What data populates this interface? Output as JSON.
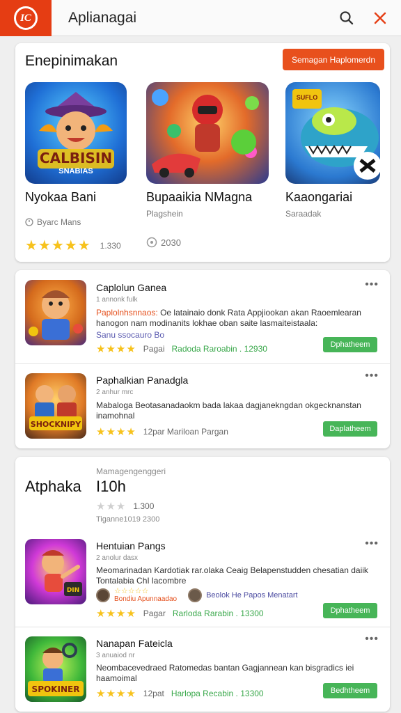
{
  "header": {
    "logo_letters": "IC",
    "title": "Aplianagai",
    "search_icon": "search-icon",
    "close_icon": "close-icon",
    "accent": "#e53d13"
  },
  "featured": {
    "title": "Enepinimakan",
    "button_label": "Semagan Haplomerdn",
    "items": [
      {
        "name": "Nyokaa Bani",
        "art_text": "CALBISIN",
        "art_sub": "SNABIAS",
        "meta": "Byarc Mans",
        "rating_value": "1.330",
        "stars": "★★★★★"
      },
      {
        "name": "Bupaaikia NMagna",
        "sub": "Plagshein",
        "rating_value": "2030"
      },
      {
        "name": "Kaaongariai",
        "sub": "Saraadak",
        "art_text": "SUFLO"
      }
    ]
  },
  "list1": {
    "items": [
      {
        "title": "Caplolun Ganea",
        "sub": "1 annonk fulk",
        "desc_highlight": "Paplolnhsnnaos:",
        "desc": " Oe latainaio donk Rata Appjiookan akan Raoemlearan hanogon nam modinanits lokhae oban saite lasmaiteistaala:",
        "tag": "Sanu ssocauro Bo",
        "rating_text": "Pagai",
        "rating_green": "Radoda Raroabin . 12930",
        "button": "Dphatheem"
      },
      {
        "title": "Paphalkian Panadgla",
        "sub": "2 anhur mrc",
        "desc": "Mabaloga Beotasanadaokm bada lakaa dagjanekngdan okgecknanstan inamohnal",
        "rating_text": "12par  Mariloan Pargan",
        "button": "Daplatheem"
      }
    ]
  },
  "section2": {
    "kicker": "Mamagengenggeri",
    "title_left": "Atphaka",
    "title_right": "I10h",
    "rating_value": "1.300",
    "meta": "Tiganne1019 2300",
    "items": [
      {
        "title": "Hentuian Pangs",
        "sub": "2 anolur dasx",
        "desc": "Meomarinadan Kardotiak rar.olaka Ceaig Belapenstudden chesatian daiik Tontalabia ChI lacombre",
        "author_stars": "☆☆☆☆☆",
        "author_name": "Bondiu Apunnaadao",
        "author2": "Beolok He Papos Menatart",
        "rating_text": "Pagar",
        "rating_green": "Rarloda Rarabin . 13300",
        "button": "Dphatheem"
      },
      {
        "title": "Nanapan Fateicla",
        "sub": "3 anuaiod nr",
        "desc": "Neombacevedraed Ratomedas bantan Gagjannean kan bisgradics iei haamoimal",
        "rating_text": "12pat",
        "rating_green": "Harlopa Recabin . 13300",
        "button": "Bedhtheem"
      }
    ]
  },
  "colors": {
    "green": "#47b558",
    "star": "#f7c21c",
    "orange": "#e8501d"
  }
}
